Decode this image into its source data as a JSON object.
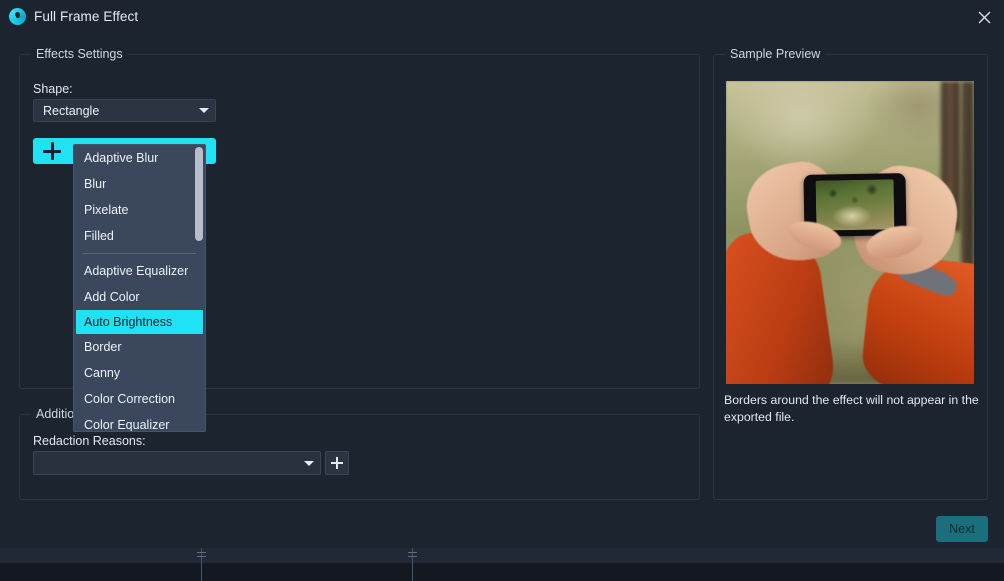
{
  "window": {
    "title": "Full Frame Effect",
    "logo_icon": "swirl-logo-icon",
    "close_icon": "close-icon"
  },
  "effects_panel": {
    "legend": "Effects Settings",
    "shape_label": "Shape:",
    "shape_value": "Rectangle",
    "shape_caret_icon": "chevron-down-icon",
    "add_effect_icon": "plus-icon",
    "dropdown": {
      "items": [
        "Adaptive Blur",
        "Blur",
        "Pixelate",
        "Filled",
        "Adaptive Equalizer",
        "Add Color",
        "Auto Brightness",
        "Border",
        "Canny",
        "Color Correction",
        "Color Equalizer"
      ],
      "separator_after_index": 3,
      "selected": "Auto Brightness",
      "scrollbar": "vertical-scrollbar"
    }
  },
  "additional_panel": {
    "legend": "Additional Settings",
    "redaction_label": "Redaction Reasons:",
    "redaction_value": "",
    "redaction_caret_icon": "chevron-down-icon",
    "add_reason_icon": "plus-icon"
  },
  "preview_panel": {
    "legend": "Sample Preview",
    "image_alt": "hands holding a smartphone photographing a forest path",
    "caption": "Borders around the effect will not appear in the exported file."
  },
  "footer": {
    "next_label": "Next"
  },
  "colors": {
    "accent_cyan": "#1fe2f5",
    "dialog_bg": "#1c2430",
    "panel_border": "#2c3644",
    "dropdown_bg": "#3a475c",
    "next_button": "#1b6e7b"
  }
}
